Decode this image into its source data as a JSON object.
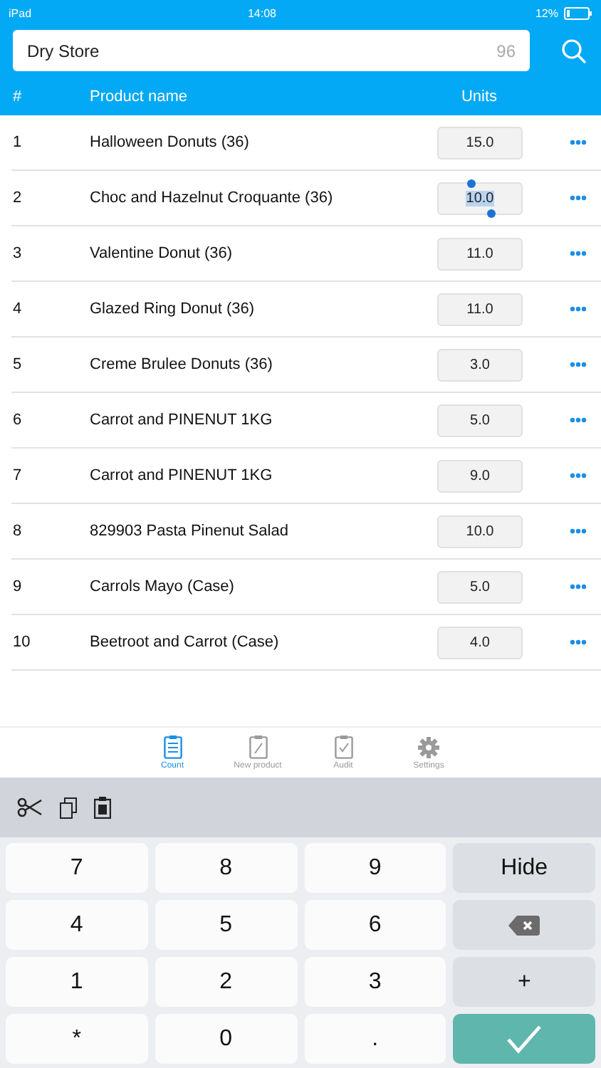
{
  "status_bar": {
    "device": "iPad",
    "time": "14:08",
    "battery": "12%"
  },
  "search": {
    "value": "Dry Store",
    "count": "96"
  },
  "table": {
    "columns": [
      "#",
      "Product name",
      "Units"
    ],
    "rows": [
      {
        "number": "1",
        "name": "Halloween Donuts (36)",
        "units": "15.0",
        "selected": false
      },
      {
        "number": "2",
        "name": "Choc and Hazelnut Croquante (36)",
        "units": "10.0",
        "selected": true
      },
      {
        "number": "3",
        "name": "Valentine Donut (36)",
        "units": "11.0",
        "selected": false
      },
      {
        "number": "4",
        "name": "Glazed Ring Donut (36)",
        "units": "11.0",
        "selected": false
      },
      {
        "number": "5",
        "name": "Creme Brulee Donuts (36)",
        "units": "3.0",
        "selected": false
      },
      {
        "number": "6",
        "name": "Carrot and PINENUT 1KG",
        "units": "5.0",
        "selected": false
      },
      {
        "number": "7",
        "name": "Carrot and PINENUT 1KG",
        "units": "9.0",
        "selected": false
      },
      {
        "number": "8",
        "name": "829903 Pasta Pinenut Salad",
        "units": "10.0",
        "selected": false
      },
      {
        "number": "9",
        "name": "Carrols Mayo  (Case)",
        "units": "5.0",
        "selected": false
      },
      {
        "number": "10",
        "name": "Beetroot and Carrot (Case)",
        "units": "4.0",
        "selected": false
      }
    ]
  },
  "tabs": [
    {
      "label": "Count",
      "kind": "count",
      "selected": true
    },
    {
      "label": "New product",
      "kind": "new",
      "selected": false
    },
    {
      "label": "Audit",
      "kind": "audit",
      "selected": false
    },
    {
      "label": "Settings",
      "kind": "settings",
      "selected": false
    }
  ],
  "keypad": [
    {
      "label": "7",
      "kind": "digit"
    },
    {
      "label": "8",
      "kind": "digit"
    },
    {
      "label": "9",
      "kind": "digit"
    },
    {
      "label": "Hide",
      "kind": "action"
    },
    {
      "label": "4",
      "kind": "digit"
    },
    {
      "label": "5",
      "kind": "digit"
    },
    {
      "label": "6",
      "kind": "digit"
    },
    {
      "kind": "backspace"
    },
    {
      "label": "1",
      "kind": "digit"
    },
    {
      "label": "2",
      "kind": "digit"
    },
    {
      "label": "3",
      "kind": "digit"
    },
    {
      "label": "+",
      "kind": "action"
    },
    {
      "label": "*",
      "kind": "digit"
    },
    {
      "label": "0",
      "kind": "digit"
    },
    {
      "label": ".",
      "kind": "digit"
    },
    {
      "kind": "done"
    }
  ]
}
